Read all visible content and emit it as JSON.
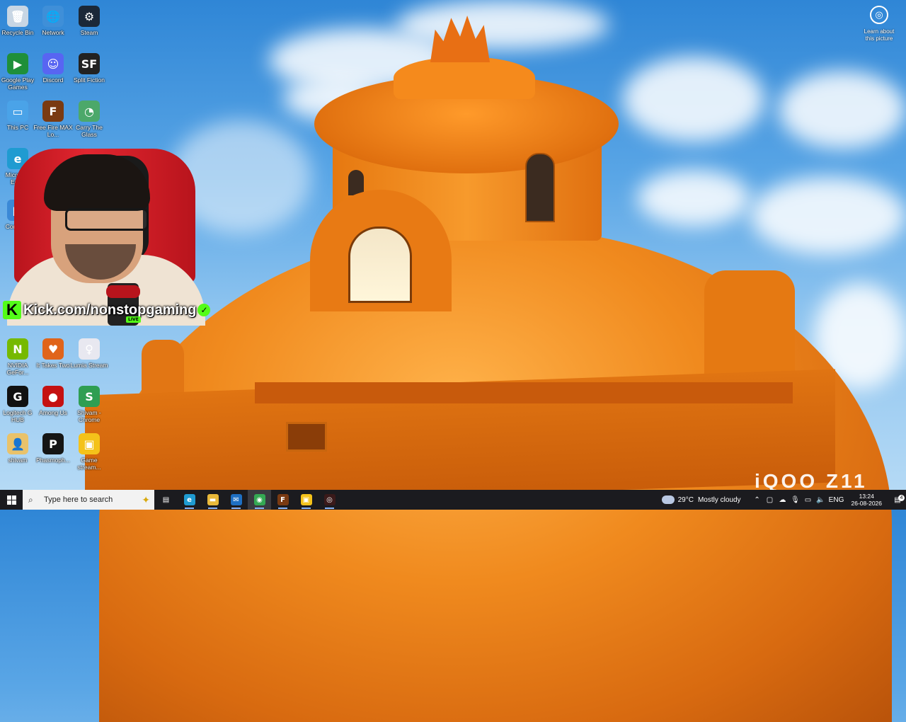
{
  "desktop": {
    "icons": [
      {
        "label": "Recycle Bin",
        "icon": "recycle-bin-icon",
        "color": "#c8d6e4",
        "glyph": "🗑"
      },
      {
        "label": "Network",
        "icon": "network-icon",
        "color": "#3f8fd8",
        "glyph": "🌐"
      },
      {
        "label": "Steam",
        "icon": "steam-icon",
        "color": "#1b2838",
        "glyph": "⚙"
      },
      {
        "label": "Google Play Games",
        "icon": "google-play-games-icon",
        "color": "#1f8f3a",
        "glyph": "▶"
      },
      {
        "label": "Discord",
        "icon": "discord-icon",
        "color": "#5865f2",
        "glyph": "☺"
      },
      {
        "label": "Split Fiction",
        "icon": "split-fiction-icon",
        "color": "#222222",
        "glyph": "SF"
      },
      {
        "label": "This PC",
        "icon": "this-pc-icon",
        "color": "#4aa3e8",
        "glyph": "▭"
      },
      {
        "label": "Free Fire MAX Lo...",
        "icon": "free-fire-icon",
        "color": "#7a3a12",
        "glyph": "F"
      },
      {
        "label": "Carry The Glass",
        "icon": "carry-the-glass-icon",
        "color": "#4ca86a",
        "glyph": "◔"
      },
      {
        "label": "Microsoft Edge",
        "icon": "edge-icon",
        "color": "#1f9bd1",
        "glyph": "e"
      },
      {
        "label": "Control...",
        "icon": "control-panel-icon",
        "color": "#3b89d6",
        "glyph": "▦"
      },
      {
        "label": "NVIDIA GeFor...",
        "icon": "nvidia-icon",
        "color": "#76b900",
        "glyph": "N"
      },
      {
        "label": "It Takes Two",
        "icon": "it-takes-two-icon",
        "color": "#e0641a",
        "glyph": "♥"
      },
      {
        "label": "Lumia Stream",
        "icon": "lumia-stream-icon",
        "color": "#e8e8f0",
        "glyph": "♀"
      },
      {
        "label": "Logitech G HUB",
        "icon": "logitech-ghub-icon",
        "color": "#111111",
        "glyph": "G"
      },
      {
        "label": "Among Us",
        "icon": "among-us-icon",
        "color": "#c51111",
        "glyph": "●"
      },
      {
        "label": "Shivam - Chrome",
        "icon": "chrome-profile-icon",
        "color": "#2f9e52",
        "glyph": "S"
      },
      {
        "label": "shivam",
        "icon": "user-folder-icon",
        "color": "#e9c26a",
        "glyph": "👤"
      },
      {
        "label": "Phasmoph...",
        "icon": "phasmophobia-icon",
        "color": "#151515",
        "glyph": "P"
      },
      {
        "label": "Game stream...",
        "icon": "game-stream-icon",
        "color": "#f4c21a",
        "glyph": "▣"
      }
    ],
    "learn_about": {
      "label": "Learn about this picture"
    },
    "watermark": "iQOO Z11"
  },
  "overlay": {
    "kick_text": "Kick.com/nonstopgaming",
    "live_label": "LIVE",
    "kick_color": "#53fc18"
  },
  "taskbar": {
    "search_placeholder": "Type here to search",
    "apps": [
      {
        "name": "task-view",
        "icon": "task-view-icon",
        "glyph": "▤",
        "color": "transparent"
      },
      {
        "name": "edge",
        "icon": "edge-icon",
        "glyph": "e",
        "color": "#1f9bd1"
      },
      {
        "name": "file-explorer",
        "icon": "folder-icon",
        "glyph": "▬",
        "color": "#e9b93a"
      },
      {
        "name": "outlook",
        "icon": "mail-icon",
        "glyph": "✉",
        "color": "#1e6fc2"
      },
      {
        "name": "chrome",
        "icon": "chrome-icon",
        "glyph": "◉",
        "color": "#34a853"
      },
      {
        "name": "free-fire",
        "icon": "free-fire-icon",
        "glyph": "F",
        "color": "#7a3a12"
      },
      {
        "name": "game-stream",
        "icon": "game-stream-icon",
        "glyph": "▣",
        "color": "#f4c21a"
      },
      {
        "name": "obs",
        "icon": "obs-icon",
        "glyph": "◎",
        "color": "#3a1a1a"
      }
    ],
    "weather": {
      "temp": "29°C",
      "condition": "Mostly cloudy"
    },
    "lang": "ENG",
    "time": "13:24",
    "date": "26-08-2026",
    "notifications": "4"
  }
}
